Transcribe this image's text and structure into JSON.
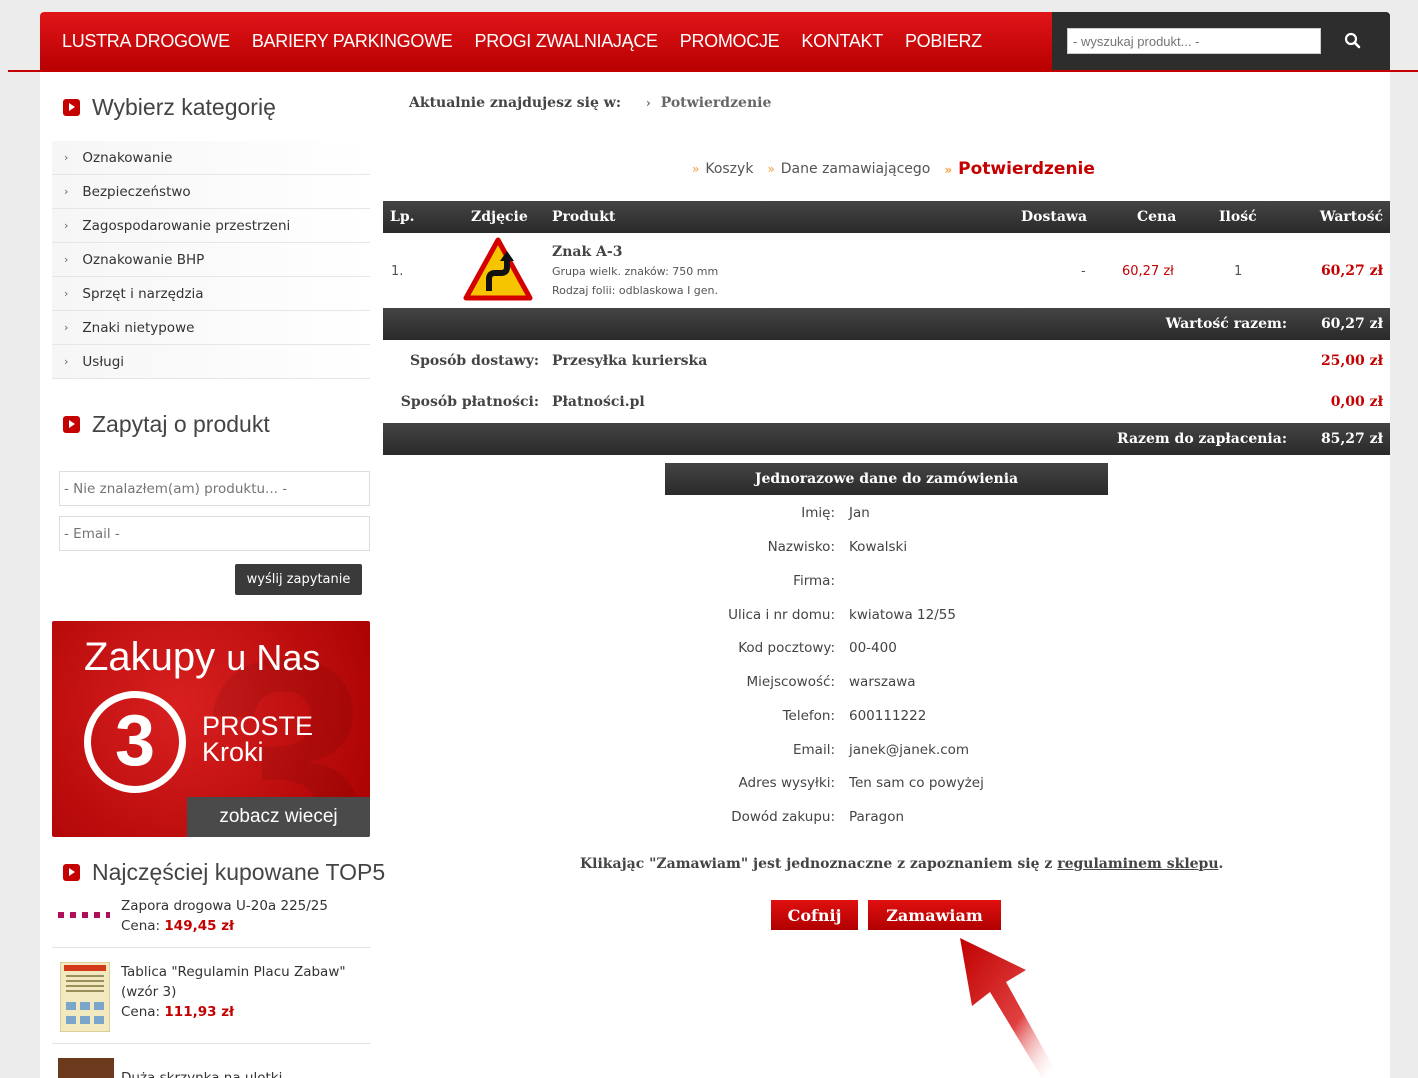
{
  "nav": {
    "items": [
      "LUSTRA DROGOWE",
      "BARIERY PARKINGOWE",
      "PROGI ZWALNIAJĄCE",
      "PROMOCJE",
      "KONTAKT",
      "POBIERZ"
    ],
    "search_placeholder": "- wyszukaj produkt... -",
    "search_icon": "search-icon",
    "accent_color": "#c40000"
  },
  "sidebar": {
    "categories_title": "Wybierz kategorię",
    "categories": [
      "Oznakowanie",
      "Bezpieczeństwo",
      "Zagospodarowanie przestrzeni",
      "Oznakowanie BHP",
      "Sprzęt i narzędzia",
      "Znaki nietypowe",
      "Usługi"
    ],
    "ask_title": "Zapytaj o produkt",
    "ask_product_placeholder": "- Nie znalazłem(am) produktu... -",
    "ask_email_placeholder": "- Email -",
    "ask_button": "wyślij zapytanie",
    "banner": {
      "word1": "Zakupy",
      "word2": "u Nas",
      "number": "3",
      "line1": "PROSTE",
      "line2": "Kroki",
      "button": "zobacz wiecej"
    },
    "top5_title": "Najczęściej kupowane TOP5",
    "top5": [
      {
        "name": "Zapora drogowa U-20a 225/25",
        "price_label": "Cena:",
        "price": "149,45 zł"
      },
      {
        "name": "Tablica \"Regulamin Placu Zabaw\" (wzór 3)",
        "price_label": "Cena:",
        "price": "111,93 zł"
      },
      {
        "name": "Duża skrzynka na ulotki",
        "price_label": "",
        "price": ""
      }
    ]
  },
  "main": {
    "breadcrumb_label": "Aktualnie znajdujesz się w:",
    "breadcrumb_current": "Potwierdzenie",
    "steps": [
      "Koszyk",
      "Dane zamawiającego",
      "Potwierdzenie"
    ],
    "table_headers": {
      "lp": "Lp.",
      "photo": "Zdjęcie",
      "product": "Produkt",
      "delivery": "Dostawa",
      "price": "Cena",
      "qty": "Ilość",
      "value": "Wartość"
    },
    "items": [
      {
        "lp": "1.",
        "name": "Znak A-3",
        "attr1": "Grupa wielk. znaków: 750 mm",
        "attr2": "Rodzaj folii: odblaskowa I gen.",
        "delivery": "-",
        "price": "60,27 zł",
        "qty": "1",
        "value": "60,27 zł"
      }
    ],
    "subtotal_label": "Wartość razem:",
    "subtotal": "60,27 zł",
    "shipping_label": "Sposób dostawy:",
    "shipping_method": "Przesyłka kurierska",
    "shipping_cost": "25,00 zł",
    "payment_label": "Sposób płatności:",
    "payment_method": "Płatności.pl",
    "payment_cost": "0,00 zł",
    "total_label": "Razem do zapłacenia:",
    "total": "85,27 zł",
    "once_title": "Jednorazowe dane do zamówienia",
    "fields": [
      {
        "label": "Imię:",
        "value": "Jan"
      },
      {
        "label": "Nazwisko:",
        "value": "Kowalski"
      },
      {
        "label": "Firma:",
        "value": ""
      },
      {
        "label": "Ulica i nr domu:",
        "value": "kwiatowa 12/55"
      },
      {
        "label": "Kod pocztowy:",
        "value": "00-400"
      },
      {
        "label": "Miejscowość:",
        "value": "warszawa"
      },
      {
        "label": "Telefon:",
        "value": "600111222"
      },
      {
        "label": "Email:",
        "value": "janek@janek.com"
      },
      {
        "label": "Adres wysyłki:",
        "value": "Ten sam co powyżej"
      },
      {
        "label": "Dowód zakupu:",
        "value": "Paragon"
      }
    ],
    "terms_before": "Klikając \"Zamawiam\" jest jednoznaczne z zapoznaniem się z ",
    "terms_link": "regulaminem sklepu",
    "terms_after": ".",
    "back_button": "Cofnij",
    "order_button": "Zamawiam"
  }
}
